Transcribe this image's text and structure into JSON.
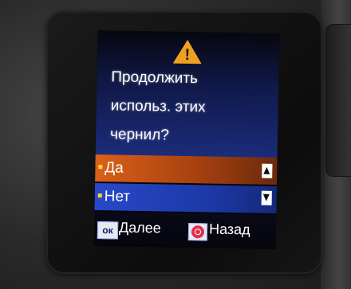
{
  "dialog": {
    "icon": "warning-icon",
    "message_lines": [
      "Продолжить",
      "использ. этих",
      "чернил?"
    ]
  },
  "options": [
    {
      "label": "Да",
      "selected": true
    },
    {
      "label": "Нет",
      "selected": false
    }
  ],
  "footer": {
    "ok_key": "ок",
    "next_label": "Далее",
    "back_icon": "stop-icon",
    "back_label": "Назад"
  },
  "colors": {
    "selected_row": "#d9611a",
    "unselected_row": "#2848c8",
    "warning": "#f0a020",
    "stop_button": "#e03050"
  }
}
